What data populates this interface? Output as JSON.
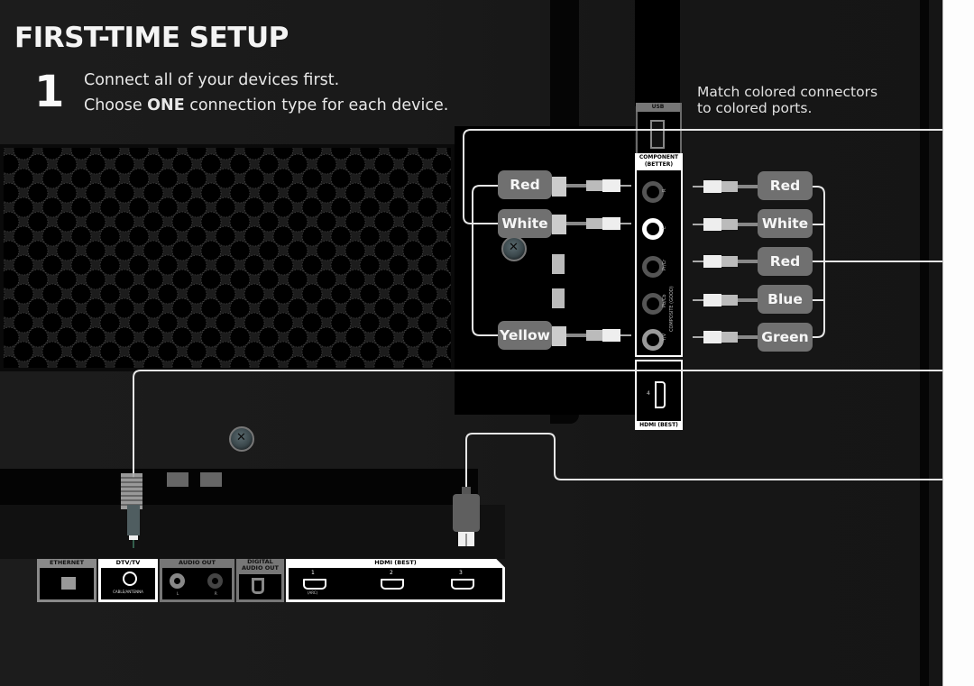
{
  "page": {
    "title": "FIRST-TIME SETUP",
    "step_number": "1",
    "step_line_1": "Connect all of your devices first.",
    "step_line_2_pre": "Choose ",
    "step_line_2_bold": "ONE",
    "step_line_2_post": " connection type for each device.",
    "hint_line_1": "Match colored connectors",
    "hint_line_2": "to colored ports."
  },
  "side_ports": {
    "usb_label": "USB",
    "component_label_1": "COMPONENT",
    "component_label_2": "(BETTER)",
    "composite_label": "COMPOSITE (GOOD)",
    "jack_labels": [
      "R",
      "L",
      "Pr/Cr",
      "Pb/Cb",
      "Y/V"
    ],
    "hdmi4_number": "4",
    "hdmi4_label": "HDMI (BEST)"
  },
  "left_cable_labels": [
    "Red",
    "White",
    "Yellow"
  ],
  "right_cable_labels": [
    "Red",
    "White",
    "Red",
    "Blue",
    "Green"
  ],
  "bottom_ports": {
    "ethernet": "ETHERNET",
    "dtv": "DTV/TV",
    "dtv_sub": "CABLE/ANTENNA",
    "audio_out": "AUDIO OUT",
    "audio_l": "L",
    "audio_r": "R",
    "digital_audio_1": "DIGITAL",
    "digital_audio_2": "AUDIO OUT",
    "hdmi_best": "HDMI (BEST)",
    "hdmi_numbers": [
      "1",
      "2",
      "3"
    ],
    "hdmi_arc": "(ARC)"
  },
  "colors": {
    "background": "#1a1a1a",
    "label_pill": "#707070",
    "wire": "#e6e6e6",
    "panel_white": "#fdfdfd"
  }
}
